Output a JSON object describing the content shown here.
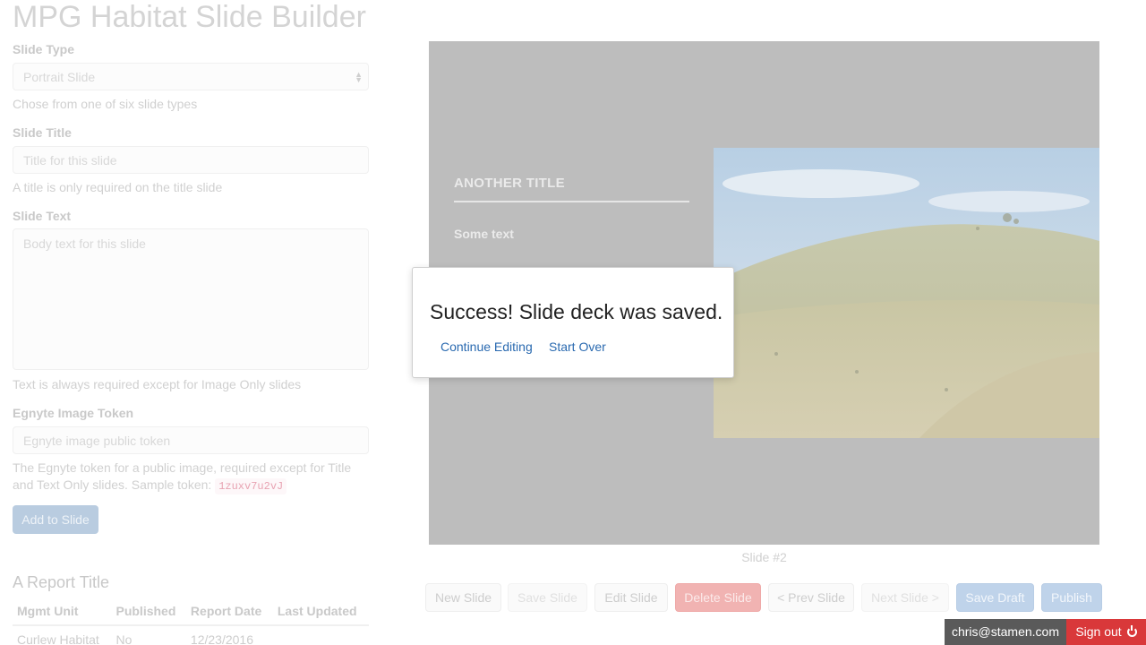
{
  "app": {
    "title": "MPG Habitat Slide Builder"
  },
  "form": {
    "slide_type": {
      "label": "Slide Type",
      "value": "Portrait Slide",
      "help": "Chose from one of six slide types"
    },
    "slide_title": {
      "label": "Slide Title",
      "placeholder": "Title for this slide",
      "help": "A title is only required on the title slide"
    },
    "slide_text": {
      "label": "Slide Text",
      "placeholder": "Body text for this slide",
      "help": "Text is always required except for Image Only slides"
    },
    "image_token": {
      "label": "Egnyte Image Token",
      "placeholder": "Egnyte image public token",
      "help": "The Egnyte token for a public image, required except for Title and Text Only slides. Sample token:",
      "sample_token": "1zuxv7u2vJ"
    },
    "add_button": "Add to Slide"
  },
  "report": {
    "title": "A Report Title",
    "columns": [
      "Mgmt Unit",
      "Published",
      "Report Date",
      "Last Updated"
    ],
    "rows": [
      [
        "Curlew Habitat",
        "No",
        "12/23/2016",
        ""
      ]
    ]
  },
  "slide": {
    "title": "ANOTHER TITLE",
    "text": "Some text",
    "caption": "Slide #2"
  },
  "toolbar": {
    "new_slide": "New Slide",
    "save_slide": "Save Slide",
    "edit_slide": "Edit Slide",
    "delete_slide": "Delete Slide",
    "prev_slide": "< Prev Slide",
    "next_slide": "Next Slide >",
    "save_draft": "Save Draft",
    "publish": "Publish"
  },
  "modal": {
    "message": "Success! Slide deck was saved.",
    "continue_label": "Continue Editing",
    "start_over_label": "Start Over"
  },
  "user": {
    "email": "chris@stamen.com",
    "signout_label": "Sign out",
    "signout_icon": "power-icon"
  },
  "colors": {
    "danger": "#d9383a",
    "link": "#2a6ab0",
    "slide_bg": "#bdbdbd"
  }
}
